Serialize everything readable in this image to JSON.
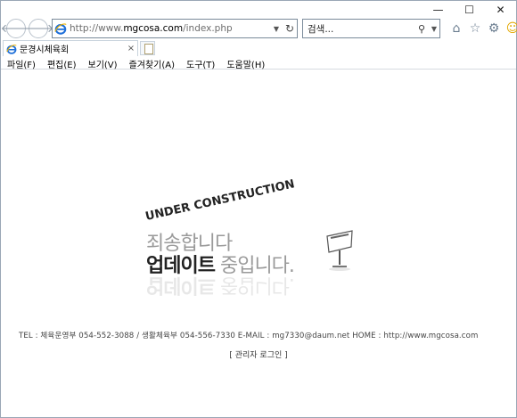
{
  "browser": {
    "url_prefix": "http://www.",
    "url_domain": "mgcosa.com",
    "url_path": "/index.php",
    "search_placeholder": "검색...",
    "tab_title": "문경시체육회",
    "tab_close": "×",
    "caption": {
      "minimize": "—",
      "maximize": "☐",
      "close": "✕"
    },
    "menus": [
      "파일(F)",
      "편집(E)",
      "보기(V)",
      "즐겨찾기(A)",
      "도구(T)",
      "도움말(H)"
    ]
  },
  "page": {
    "construction_title": "UNDER CONSTRUCTION",
    "apology": "죄송합니다",
    "update_bold": "업데이트",
    "update_light": " 중입니다.",
    "footer_info": "TEL : 체육운영부 054-552-3088 / 생활체육부 054-556-7330    E-MAIL : mg7330@daum.net    HOME : http://www.mgcosa.com",
    "admin_login": "[ 관리자 로그인 ]"
  },
  "colors": {
    "accent_blue": "#1e6fd9",
    "ie_yellow": "#f0b400",
    "text_grey": "#9a9a9a"
  },
  "icons": {
    "back": "back-arrow-icon",
    "forward": "forward-arrow-icon",
    "home": "home-icon",
    "favorites": "star-icon",
    "settings": "gear-icon",
    "feedback": "smiley-icon"
  }
}
